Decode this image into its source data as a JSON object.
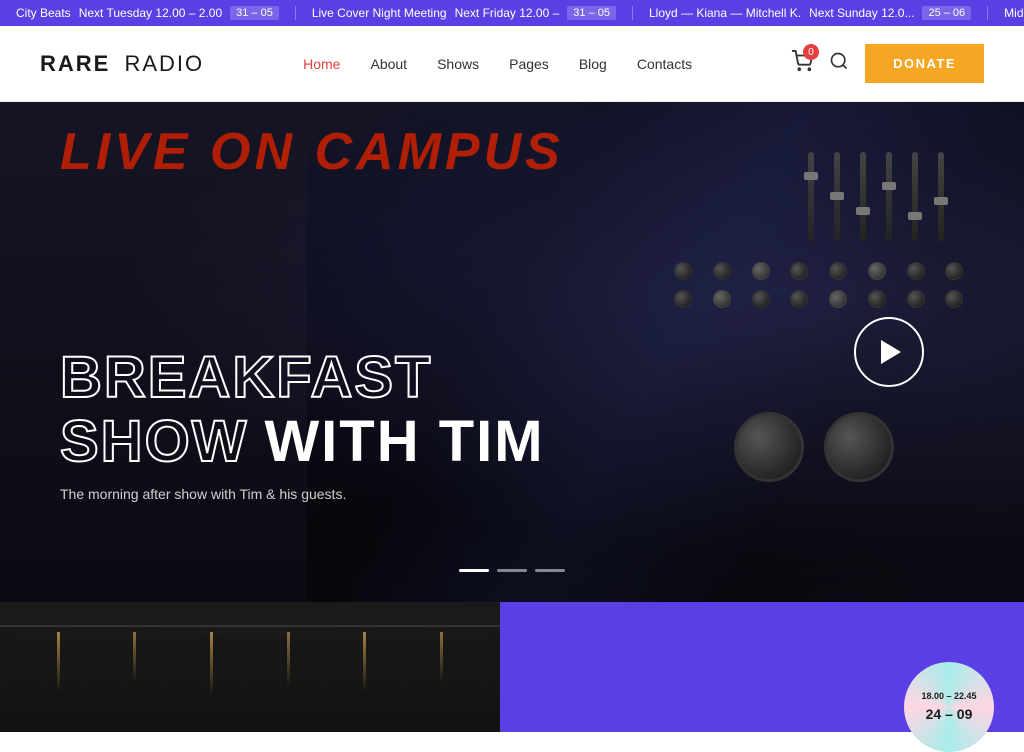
{
  "ticker": {
    "items": [
      {
        "title": "City Beats",
        "time": "Next Tuesday 12.00 – 2.00",
        "date": "31 – 05"
      },
      {
        "title": "Live Cover Night Meeting",
        "time": "Next Friday 12.00 –",
        "date": "31 – 05"
      },
      {
        "title": "Lloyd — Kiana — Mitchell K.",
        "time": "Next Sunday 12.0...",
        "date": "25 – 06"
      },
      {
        "title": "Midday",
        "time": "",
        "date": ""
      }
    ]
  },
  "header": {
    "logo_rare": "RARE",
    "logo_radio": "RADIO",
    "nav": [
      {
        "label": "Home",
        "active": true
      },
      {
        "label": "About",
        "active": false
      },
      {
        "label": "Shows",
        "active": false
      },
      {
        "label": "Pages",
        "active": false
      },
      {
        "label": "Blog",
        "active": false
      },
      {
        "label": "Contacts",
        "active": false
      }
    ],
    "cart_count": "0",
    "donate_label": "DONATE"
  },
  "hero": {
    "campus_text": "LIVE ON CAMPUS",
    "title_outline": "BREAKFAST",
    "title_solid_1": "SHOW",
    "title_solid_2": "WITH TIM",
    "subtitle": "The morning after show with Tim & his guests.",
    "slides": [
      {
        "active": true
      },
      {
        "active": false
      },
      {
        "active": false
      }
    ]
  },
  "bottom": {
    "badge_time": "18.00 – 22.45",
    "badge_date": "24 – 09"
  }
}
